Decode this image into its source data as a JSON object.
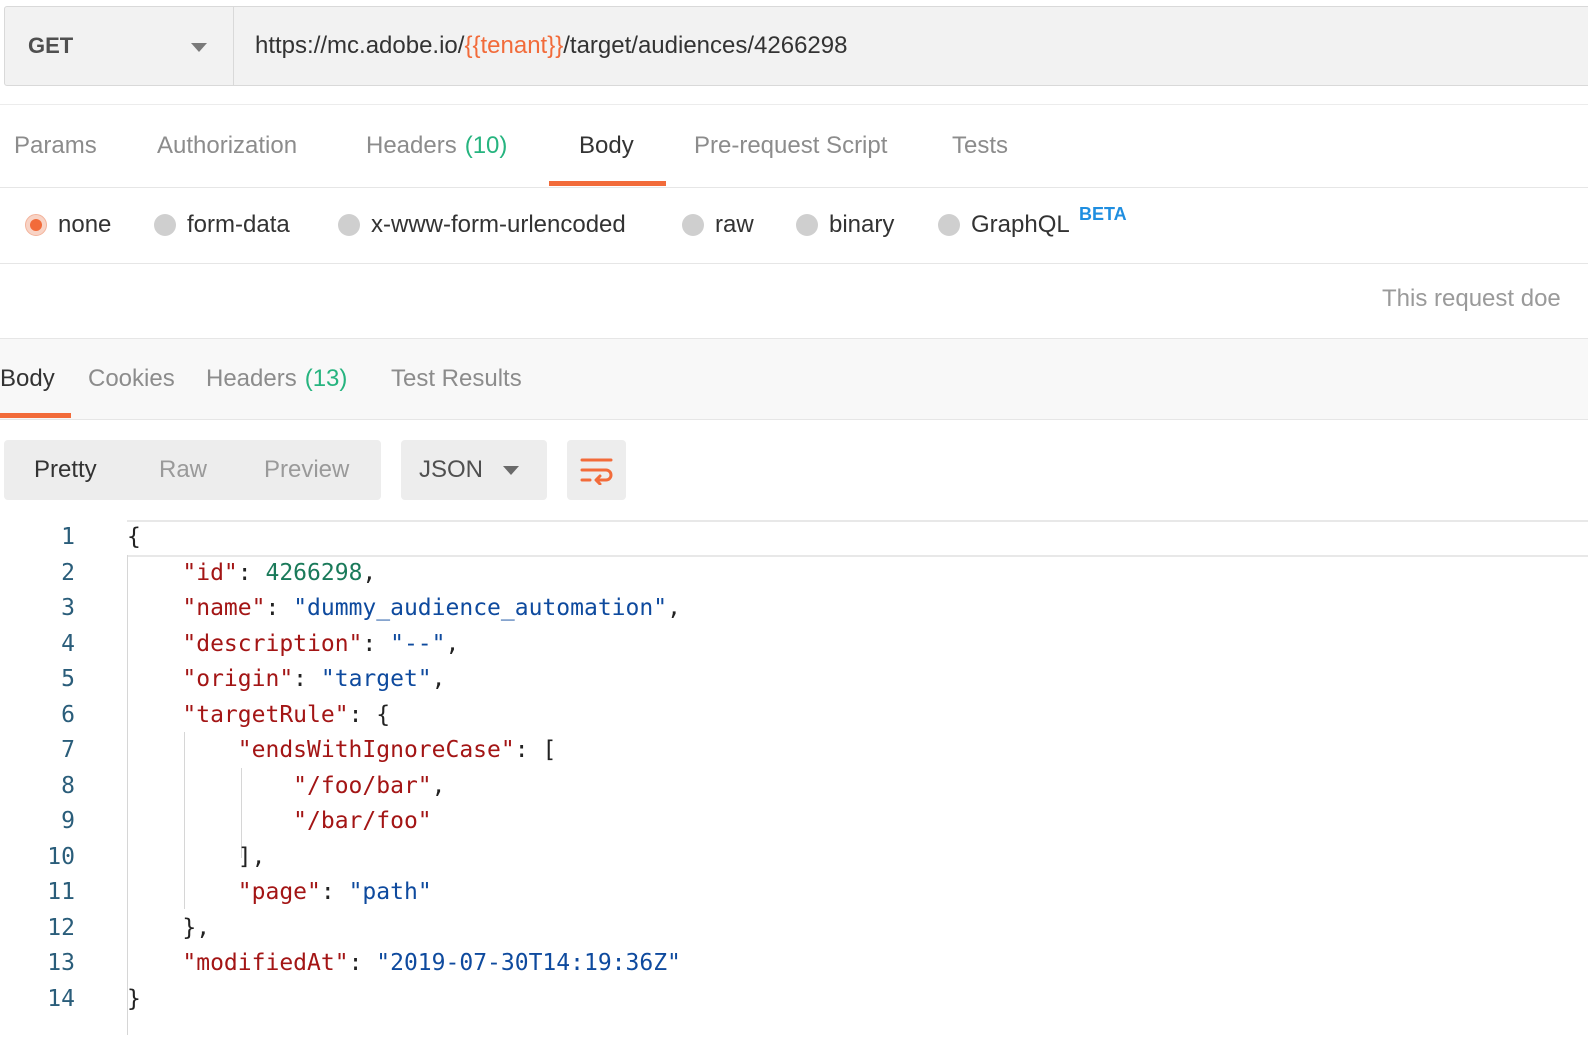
{
  "request": {
    "method": "GET",
    "url_prefix": "https://mc.adobe.io/",
    "url_variable": "{{tenant}}",
    "url_suffix": "/target/audiences/4266298"
  },
  "request_tabs": [
    {
      "label": "Params"
    },
    {
      "label": "Authorization"
    },
    {
      "label": "Headers",
      "count": "(10)"
    },
    {
      "label": "Body",
      "active": true
    },
    {
      "label": "Pre-request Script"
    },
    {
      "label": "Tests"
    }
  ],
  "body_types": [
    {
      "label": "none",
      "selected": true
    },
    {
      "label": "form-data"
    },
    {
      "label": "x-www-form-urlencoded"
    },
    {
      "label": "raw"
    },
    {
      "label": "binary"
    },
    {
      "label": "GraphQL",
      "badge": "BETA"
    }
  ],
  "body_notice": "This request doe",
  "response_tabs": [
    {
      "label": "Body",
      "active": true
    },
    {
      "label": "Cookies"
    },
    {
      "label": "Headers",
      "count": "(13)"
    },
    {
      "label": "Test Results"
    }
  ],
  "view_modes": [
    {
      "label": "Pretty",
      "selected": true
    },
    {
      "label": "Raw"
    },
    {
      "label": "Preview"
    }
  ],
  "format": "JSON",
  "icons": {
    "method_caret": "chevron-down-icon",
    "format_caret": "chevron-down-icon",
    "wrap": "wrap-lines-icon"
  },
  "colors": {
    "accent": "#f26b3a",
    "count": "#26b47f",
    "beta": "#1f8ee0",
    "json_key": "#a31515",
    "json_string": "#0e4a9e",
    "json_number": "#1a7a5a"
  },
  "response_body": {
    "line_numbers": [
      "1",
      "2",
      "3",
      "4",
      "5",
      "6",
      "7",
      "8",
      "9",
      "10",
      "11",
      "12",
      "13",
      "14"
    ],
    "tokens": {
      "open": "{",
      "id_key": "\"id\"",
      "id_val": "4266298",
      "name_key": "\"name\"",
      "name_val": "\"dummy_audience_automation\"",
      "desc_key": "\"description\"",
      "desc_val": "\"--\"",
      "origin_key": "\"origin\"",
      "origin_val": "\"target\"",
      "rule_key": "\"targetRule\"",
      "rule_open": "{",
      "ends_key": "\"endsWithIgnoreCase\"",
      "arr_open": "[",
      "item1": "\"/foo/bar\"",
      "item2": "\"/bar/foo\"",
      "arr_close": "],",
      "page_key": "\"page\"",
      "page_val": "\"path\"",
      "rule_close": "},",
      "mod_key": "\"modifiedAt\"",
      "mod_val": "\"2019-07-30T14:19:36Z\"",
      "close": "}",
      "colon": ": ",
      "comma": ","
    }
  }
}
